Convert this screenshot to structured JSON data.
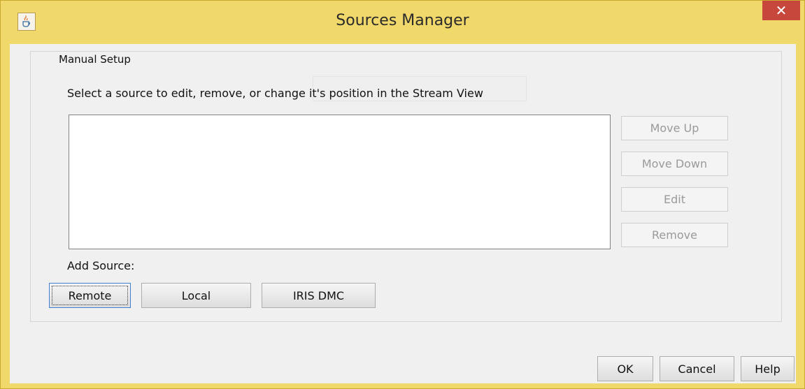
{
  "window": {
    "title": "Sources Manager",
    "close_label": "✕",
    "icon": "java-cup-icon"
  },
  "manual_setup": {
    "group_title": "Manual Setup",
    "hint": "Select a source to edit, remove, or change it's position in the Stream View",
    "sources": [],
    "side_buttons": {
      "move_up": "Move Up",
      "move_down": "Move Down",
      "edit": "Edit",
      "remove": "Remove"
    },
    "add_source_label": "Add Source:",
    "add_buttons": {
      "remote": "Remote",
      "local": "Local",
      "iris_dmc": "IRIS DMC"
    }
  },
  "footer": {
    "ok": "OK",
    "cancel": "Cancel",
    "help": "Help"
  },
  "colors": {
    "frame": "#f0d86a",
    "close": "#c7473d",
    "client": "#f0f0f0",
    "disabled_text": "#9a9a9a"
  }
}
